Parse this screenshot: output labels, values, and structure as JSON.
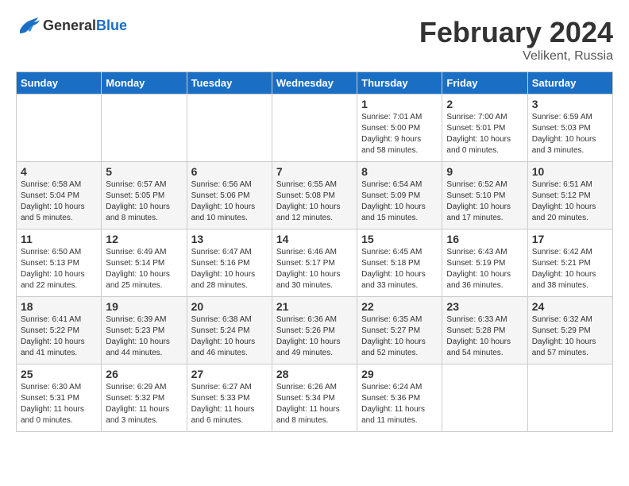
{
  "header": {
    "logo_general": "General",
    "logo_blue": "Blue",
    "title": "February 2024",
    "subtitle": "Velikent, Russia"
  },
  "days_of_week": [
    "Sunday",
    "Monday",
    "Tuesday",
    "Wednesday",
    "Thursday",
    "Friday",
    "Saturday"
  ],
  "weeks": [
    [
      {
        "day": "",
        "info": ""
      },
      {
        "day": "",
        "info": ""
      },
      {
        "day": "",
        "info": ""
      },
      {
        "day": "",
        "info": ""
      },
      {
        "day": "1",
        "info": "Sunrise: 7:01 AM\nSunset: 5:00 PM\nDaylight: 9 hours\nand 58 minutes."
      },
      {
        "day": "2",
        "info": "Sunrise: 7:00 AM\nSunset: 5:01 PM\nDaylight: 10 hours\nand 0 minutes."
      },
      {
        "day": "3",
        "info": "Sunrise: 6:59 AM\nSunset: 5:03 PM\nDaylight: 10 hours\nand 3 minutes."
      }
    ],
    [
      {
        "day": "4",
        "info": "Sunrise: 6:58 AM\nSunset: 5:04 PM\nDaylight: 10 hours\nand 5 minutes."
      },
      {
        "day": "5",
        "info": "Sunrise: 6:57 AM\nSunset: 5:05 PM\nDaylight: 10 hours\nand 8 minutes."
      },
      {
        "day": "6",
        "info": "Sunrise: 6:56 AM\nSunset: 5:06 PM\nDaylight: 10 hours\nand 10 minutes."
      },
      {
        "day": "7",
        "info": "Sunrise: 6:55 AM\nSunset: 5:08 PM\nDaylight: 10 hours\nand 12 minutes."
      },
      {
        "day": "8",
        "info": "Sunrise: 6:54 AM\nSunset: 5:09 PM\nDaylight: 10 hours\nand 15 minutes."
      },
      {
        "day": "9",
        "info": "Sunrise: 6:52 AM\nSunset: 5:10 PM\nDaylight: 10 hours\nand 17 minutes."
      },
      {
        "day": "10",
        "info": "Sunrise: 6:51 AM\nSunset: 5:12 PM\nDaylight: 10 hours\nand 20 minutes."
      }
    ],
    [
      {
        "day": "11",
        "info": "Sunrise: 6:50 AM\nSunset: 5:13 PM\nDaylight: 10 hours\nand 22 minutes."
      },
      {
        "day": "12",
        "info": "Sunrise: 6:49 AM\nSunset: 5:14 PM\nDaylight: 10 hours\nand 25 minutes."
      },
      {
        "day": "13",
        "info": "Sunrise: 6:47 AM\nSunset: 5:16 PM\nDaylight: 10 hours\nand 28 minutes."
      },
      {
        "day": "14",
        "info": "Sunrise: 6:46 AM\nSunset: 5:17 PM\nDaylight: 10 hours\nand 30 minutes."
      },
      {
        "day": "15",
        "info": "Sunrise: 6:45 AM\nSunset: 5:18 PM\nDaylight: 10 hours\nand 33 minutes."
      },
      {
        "day": "16",
        "info": "Sunrise: 6:43 AM\nSunset: 5:19 PM\nDaylight: 10 hours\nand 36 minutes."
      },
      {
        "day": "17",
        "info": "Sunrise: 6:42 AM\nSunset: 5:21 PM\nDaylight: 10 hours\nand 38 minutes."
      }
    ],
    [
      {
        "day": "18",
        "info": "Sunrise: 6:41 AM\nSunset: 5:22 PM\nDaylight: 10 hours\nand 41 minutes."
      },
      {
        "day": "19",
        "info": "Sunrise: 6:39 AM\nSunset: 5:23 PM\nDaylight: 10 hours\nand 44 minutes."
      },
      {
        "day": "20",
        "info": "Sunrise: 6:38 AM\nSunset: 5:24 PM\nDaylight: 10 hours\nand 46 minutes."
      },
      {
        "day": "21",
        "info": "Sunrise: 6:36 AM\nSunset: 5:26 PM\nDaylight: 10 hours\nand 49 minutes."
      },
      {
        "day": "22",
        "info": "Sunrise: 6:35 AM\nSunset: 5:27 PM\nDaylight: 10 hours\nand 52 minutes."
      },
      {
        "day": "23",
        "info": "Sunrise: 6:33 AM\nSunset: 5:28 PM\nDaylight: 10 hours\nand 54 minutes."
      },
      {
        "day": "24",
        "info": "Sunrise: 6:32 AM\nSunset: 5:29 PM\nDaylight: 10 hours\nand 57 minutes."
      }
    ],
    [
      {
        "day": "25",
        "info": "Sunrise: 6:30 AM\nSunset: 5:31 PM\nDaylight: 11 hours\nand 0 minutes."
      },
      {
        "day": "26",
        "info": "Sunrise: 6:29 AM\nSunset: 5:32 PM\nDaylight: 11 hours\nand 3 minutes."
      },
      {
        "day": "27",
        "info": "Sunrise: 6:27 AM\nSunset: 5:33 PM\nDaylight: 11 hours\nand 6 minutes."
      },
      {
        "day": "28",
        "info": "Sunrise: 6:26 AM\nSunset: 5:34 PM\nDaylight: 11 hours\nand 8 minutes."
      },
      {
        "day": "29",
        "info": "Sunrise: 6:24 AM\nSunset: 5:36 PM\nDaylight: 11 hours\nand 11 minutes."
      },
      {
        "day": "",
        "info": ""
      },
      {
        "day": "",
        "info": ""
      }
    ]
  ]
}
